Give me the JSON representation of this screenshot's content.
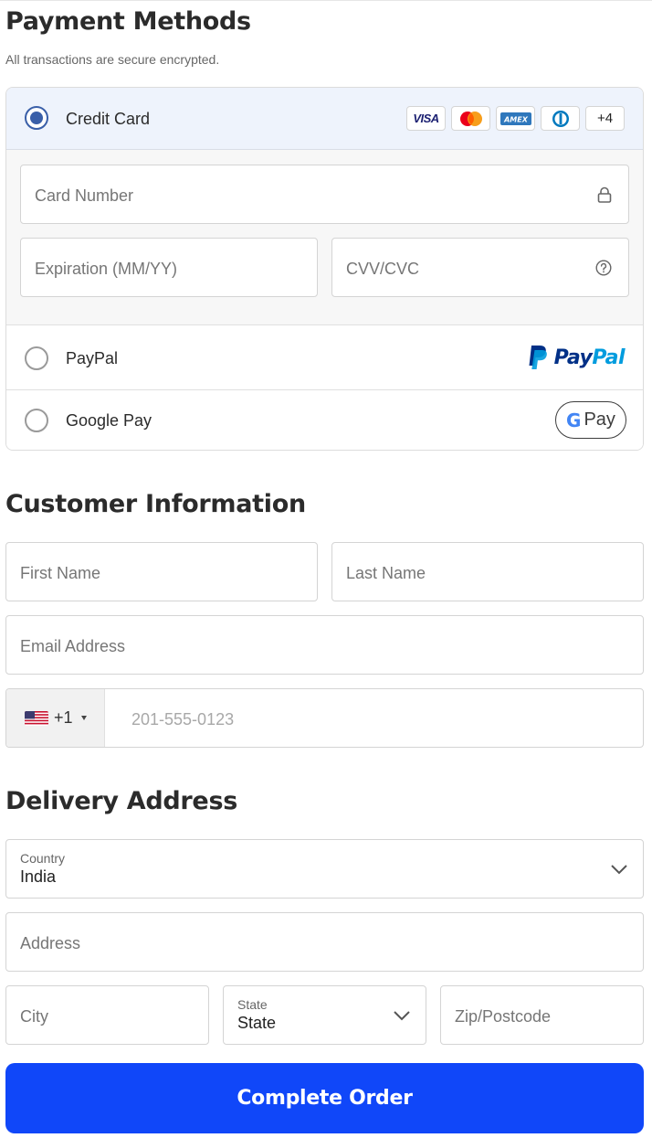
{
  "payment": {
    "title": "Payment Methods",
    "subtitle": "All transactions are secure encrypted.",
    "credit_card": {
      "label": "Credit Card",
      "selected": true,
      "logos": [
        {
          "name": "visa",
          "text": "VISA"
        },
        {
          "name": "mastercard"
        },
        {
          "name": "amex",
          "text": "AMEX"
        },
        {
          "name": "diners"
        },
        {
          "name": "more",
          "text": "+4"
        }
      ],
      "card_number_placeholder": "Card Number",
      "expiration_placeholder": "Expiration (MM/YY)",
      "cvv_placeholder": "CVV/CVC"
    },
    "paypal": {
      "label": "PayPal",
      "logo_text_a": "Pay",
      "logo_text_b": "Pal",
      "selected": false
    },
    "google_pay": {
      "label": "Google Pay",
      "logo_g": "G",
      "logo_pay": "Pay",
      "selected": false
    }
  },
  "customer": {
    "title": "Customer Information",
    "first_name_placeholder": "First Name",
    "last_name_placeholder": "Last Name",
    "email_placeholder": "Email Address",
    "phone_code": "+1",
    "phone_flag": "us-flag-icon",
    "phone_placeholder": "201-555-0123"
  },
  "delivery": {
    "title": "Delivery Address",
    "country_label": "Country",
    "country_value": "India",
    "address_placeholder": "Address",
    "city_placeholder": "City",
    "state_label": "State",
    "state_value": "State",
    "zip_placeholder": "Zip/Postcode"
  },
  "submit_label": "Complete Order",
  "colors": {
    "primary": "#1047f9",
    "radio_selected": "#3a5fa8",
    "selected_bg": "#eef3fc",
    "paypal_dark": "#003087",
    "paypal_light": "#009cde"
  }
}
